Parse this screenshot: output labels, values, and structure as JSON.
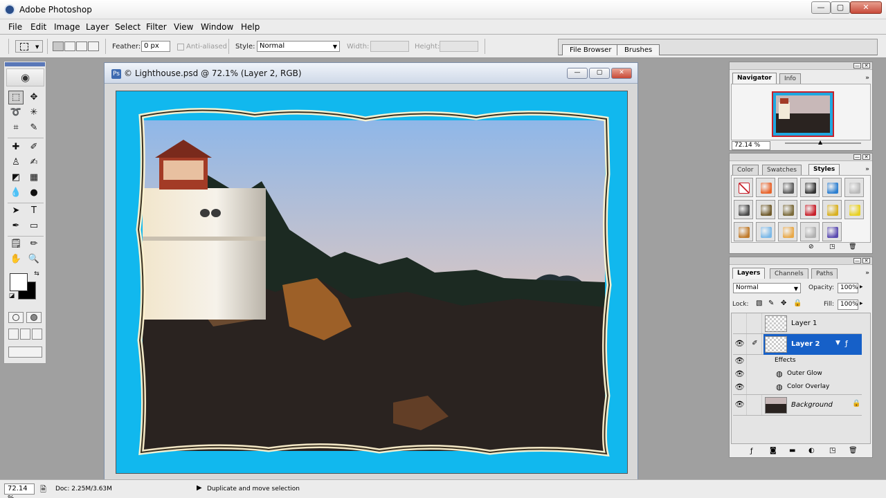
{
  "app": {
    "title": "Adobe Photoshop",
    "window_controls": {
      "minimize": "—",
      "maximize": "▢",
      "close": "✕"
    }
  },
  "menu": [
    "File",
    "Edit",
    "Image",
    "Layer",
    "Select",
    "Filter",
    "View",
    "Window",
    "Help"
  ],
  "options_bar": {
    "feather_label": "Feather:",
    "feather_value": "0 px",
    "anti_aliased_label": "Anti-aliased",
    "style_label": "Style:",
    "style_value": "Normal",
    "width_label": "Width:",
    "height_label": "Height:"
  },
  "palette_well": {
    "tabs": [
      "File Browser",
      "Brushes"
    ]
  },
  "document": {
    "title": "© Lighthouse.psd @ 72.1% (Layer 2, RGB)",
    "frame_color": "#11b8ee"
  },
  "navigator": {
    "tabs": [
      "Navigator",
      "Info"
    ],
    "zoom": "72.14 %"
  },
  "styles_panel": {
    "tabs": [
      "Color",
      "Swatches",
      "Styles"
    ],
    "swatch_colors": [
      "none",
      "#e8632a",
      "#5a5a5a",
      "#333333",
      "#2d7fd0",
      "#b9b9b9",
      "#4a4a4a",
      "#6f5a2a",
      "#7a6a3a",
      "#c8202a",
      "#d8b020",
      "#e8d020",
      "#c07a2a",
      "#7ab8e8",
      "#e8a848",
      "#b0b0b0",
      "#5a4ab0"
    ]
  },
  "layers_panel": {
    "tabs": [
      "Layers",
      "Channels",
      "Paths"
    ],
    "blend_mode": "Normal",
    "opacity_label": "Opacity:",
    "opacity": "100%",
    "lock_label": "Lock:",
    "fill_label": "Fill:",
    "fill": "100%",
    "layers": [
      {
        "name": "Layer 1",
        "visible": false,
        "selected": false
      },
      {
        "name": "Layer 2",
        "visible": true,
        "selected": true
      },
      {
        "name": "Background",
        "visible": true,
        "selected": false,
        "locked": true
      }
    ],
    "effects_label": "Effects",
    "effects": [
      "Outer Glow",
      "Color Overlay"
    ]
  },
  "status": {
    "zoom": "72.14 %",
    "doc_info": "Doc: 2.25M/3.63M",
    "message": "Duplicate and move selection"
  }
}
